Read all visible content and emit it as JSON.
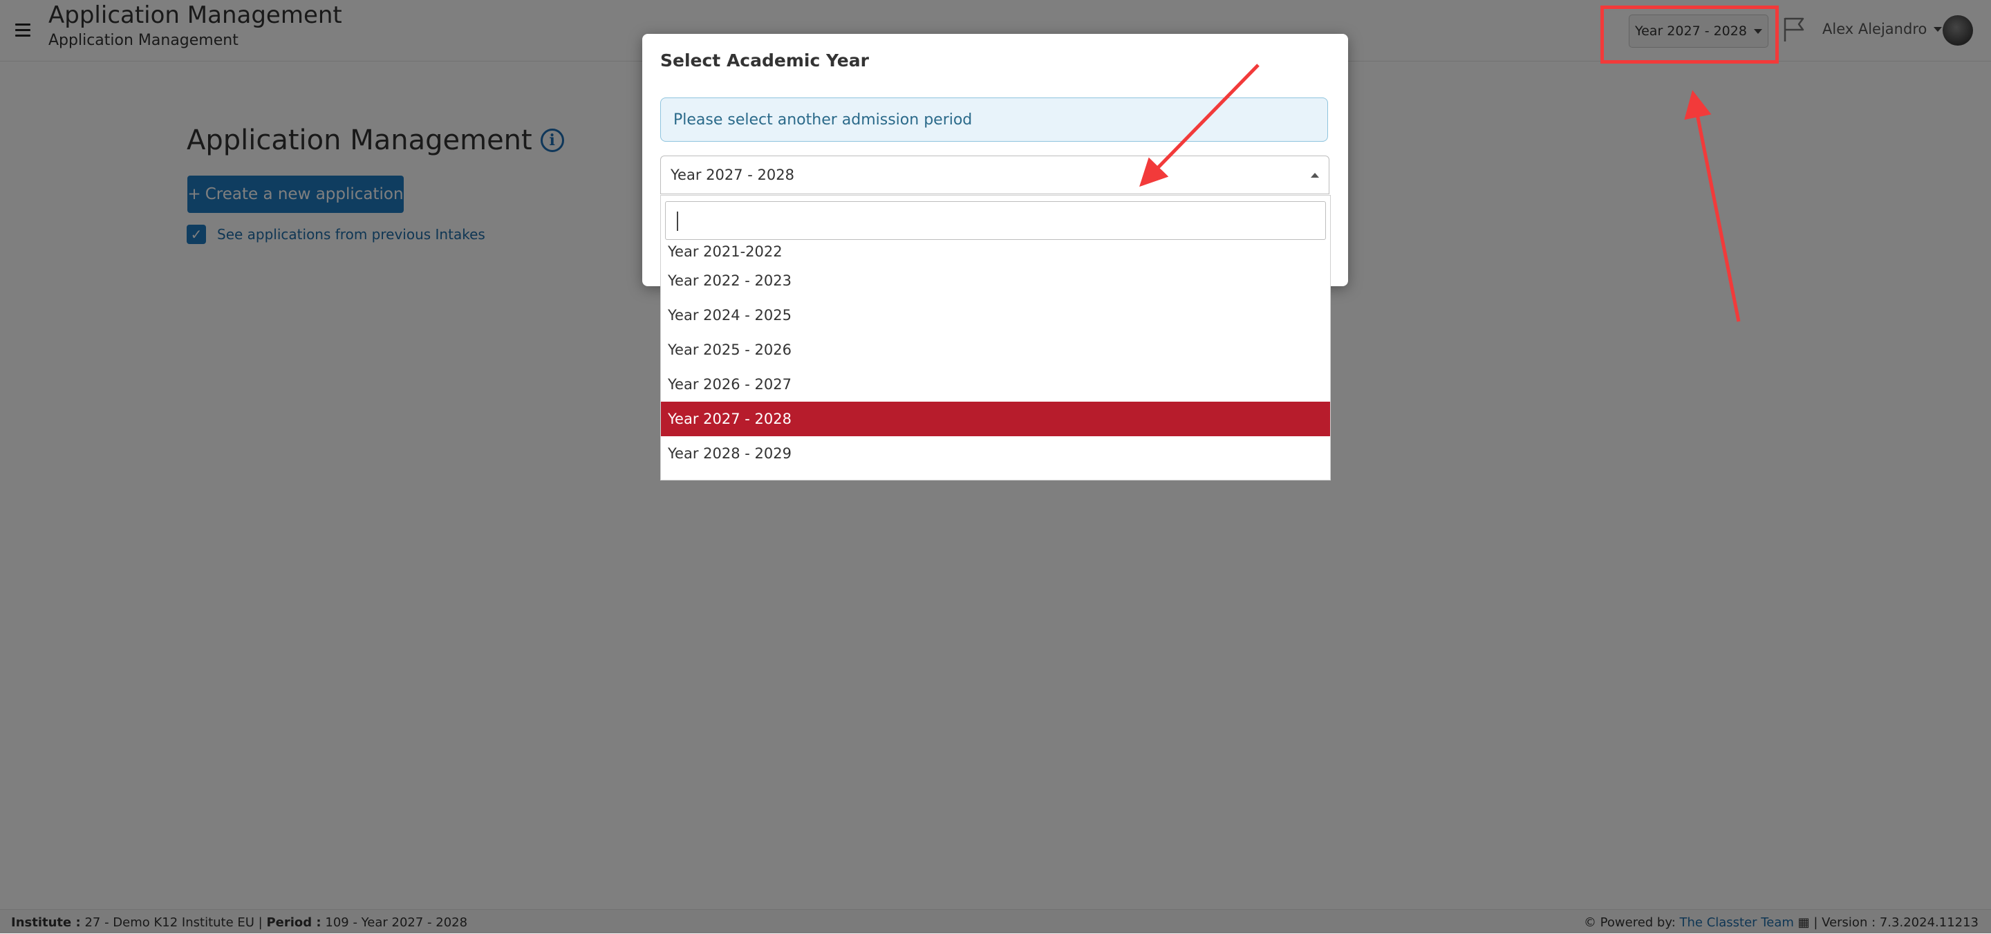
{
  "header": {
    "title": "Application Management",
    "subtitle": "Application Management",
    "year_selector": "Year 2027 - 2028",
    "user_name": "Alex Alejandro"
  },
  "main": {
    "title": "Application Management",
    "create_button": "Create a new application",
    "previous_intakes_label": "See applications from previous Intakes",
    "previous_intakes_checked": true
  },
  "footer": {
    "institute_label": "Institute :",
    "institute_value": "27 - Demo K12 Institute EU",
    "period_label": "Period :",
    "period_value": "109 - Year 2027 - 2028",
    "powered_by_label": "Powered by:",
    "powered_by_link": "The Classter Team",
    "version_text": "| Version : 7.3.2024.11213"
  },
  "modal": {
    "title": "Select Academic Year",
    "alert_text": "Please select another admission period",
    "selected_value": "Year 2027 - 2028",
    "search_value": "",
    "options": [
      "Year 2021-2022",
      "Year 2022 - 2023",
      "Year 2024 - 2025",
      "Year 2025 - 2026",
      "Year 2026 - 2027",
      "Year 2027 - 2028",
      "Year 2028 - 2029"
    ],
    "selected_index": 5
  },
  "colors": {
    "primary": "#1f7bc1",
    "selected_option": "#b71c2c",
    "annotation": "#f23a3a",
    "alert_bg": "#e8f3fa"
  }
}
